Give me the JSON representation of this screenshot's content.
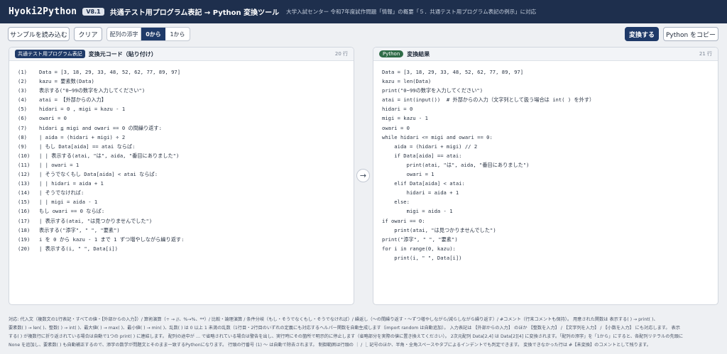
{
  "header": {
    "brand": "Hyoki2Python",
    "version": "V8.1",
    "title": "共通テスト用プログラム表記 → Python 変換ツール",
    "subtitle": "大学入試センター 令和7年度試作問題「情報」の概要「５．共通テスト用プログラム表記の例示」に対応"
  },
  "toolbar": {
    "load_sample": "サンプルを読み込む",
    "clear": "クリア",
    "index_label": "配列の添字",
    "index_zero": "0から",
    "index_one": "1から",
    "convert": "変換する",
    "copy_python": "Python をコピー"
  },
  "left_panel": {
    "tag": "共通テスト用プログラム表記",
    "title": "変換元コード（貼り付け）",
    "line_count": "20 行",
    "lines": [
      {
        "num": "(1)",
        "text": "Data = [3, 18, 29, 33, 48, 52, 62, 77, 89, 97]"
      },
      {
        "num": "(2)",
        "text": "kazu = 要素数(Data)"
      },
      {
        "num": "(3)",
        "text": "表示する(\"0~99の数字を入力してください\")"
      },
      {
        "num": "(4)",
        "text": "atai = 【外部からの入力】"
      },
      {
        "num": "(5)",
        "text": "hidari = 0 , migi = kazu - 1"
      },
      {
        "num": "(6)",
        "text": "owari = 0"
      },
      {
        "num": "(7)",
        "text": "hidari ≦ migi and owari == 0 の間繰り返す:"
      },
      {
        "num": "(8)",
        "text": "| aida = (hidari + migi) ÷ 2"
      },
      {
        "num": "(9)",
        "text": "| もし Data[aida] == atai ならば:"
      },
      {
        "num": "(10)",
        "text": "| | 表示する(atai, \"は\", aida, \"番目にありました\")"
      },
      {
        "num": "(11)",
        "text": "| | owari = 1"
      },
      {
        "num": "(12)",
        "text": "| そうでなくもし Data[aida] < atai ならば:"
      },
      {
        "num": "(13)",
        "text": "| | hidari = aida + 1"
      },
      {
        "num": "(14)",
        "text": "| そうでなければ:"
      },
      {
        "num": "(15)",
        "text": "| | migi = aida - 1"
      },
      {
        "num": "(16)",
        "text": "もし owari == 0 ならば:"
      },
      {
        "num": "(17)",
        "text": "| 表示する(atai, \"は見つかりませんでした\")"
      },
      {
        "num": "(18)",
        "text": "表示する(\"添字\", \" \", \"要素\")"
      },
      {
        "num": "(19)",
        "text": "i を 0 から kazu - 1 まで 1 ずつ増やしながら繰り返す:"
      },
      {
        "num": "(20)",
        "text": "| 表示する(i, \" \", Data[i])"
      }
    ]
  },
  "right_panel": {
    "tag": "Python",
    "title": "変換結果",
    "line_count": "21 行",
    "lines": [
      "Data = [3, 18, 29, 33, 48, 52, 62, 77, 89, 97]",
      "kazu = len(Data)",
      "print(\"0~99の数字を入力してください\")",
      "atai = int(input())  # 外部からの入力（文字列として扱う場合は int( ) を外す）",
      "hidari = 0",
      "migi = kazu - 1",
      "owari = 0",
      "while hidari <= migi and owari == 0:",
      "    aida = (hidari + migi) // 2",
      "    if Data[aida] == atai:",
      "        print(atai, \"は\", aida, \"番目にありました\")",
      "        owari = 1",
      "    elif Data[aida] < atai:",
      "        hidari = aida + 1",
      "    else:",
      "        migi = aida - 1",
      "if owari == 0:",
      "    print(atai, \"は見つかりませんでした\")",
      "print(\"添字\", \" \", \"要素\")",
      "for i in range(0, kazu):",
      "    print(i, \" \", Data[i])"
    ]
  },
  "notes": [
    "対応: 代入文（複数文の1行表記・すべての値・【外部からの入力】）/ 算術演算（÷ → //、%→%、**）/ 比較・論理演算 / 条件分岐（もし・そうでなくもし・そうでなければ）/ 繰返し（〜の間繰り返す・〜ずつ増やしながら/減らしながら繰り返す）/ #コメント（行末コメントも保持）。 用意された関数は 表示する( ) → print( )、",
    "要素数( ) → len( )、整数( ) → int( )、最大値( ) → max( )、最小値( ) → min( )、乱数( ) は 0 以上 1 未満の乱数（1行目・2行目のいずれの定義にも対応するヘルパー関数を自動生成します（import random は自動追加）。 入力表記は 【外部からの入力】 のほか 【整数を入力】 / 【文字列を入力】 / 【小数を入力】 にも対応します。 表示",
    "する( ) が複数行に折り返されている場合は自動で1つの print( ) に連結します。 配列の途中が … で省略されている場合は警告を出し、実行時にその箇所で明示的に停止します（省略部分を実際の値に置き換えてください）。 2次元配列 Data[2,4] は Data[2][4] に変換されます。「配列の添字」を「1から」にすると、各配列リテラルの先頭に",
    "None を追加し、要素数( ) も自動補正するので、添字の数学が問題文とそのまま一致するPythonになります。 行頭の行番号 (1) 〜 は自動で除去されます。 制御範囲は行頭の ｜ / ⎿ 記号のほか、半角・全角スペースやタブによるインデントでも判定できます。 変換できなかった行は #【未変換】のコメントとして残ります。"
  ],
  "colors": {
    "header_bg": "#1e2f4d",
    "primary_button": "#1f3a68",
    "python_tag": "#2f6b47"
  }
}
